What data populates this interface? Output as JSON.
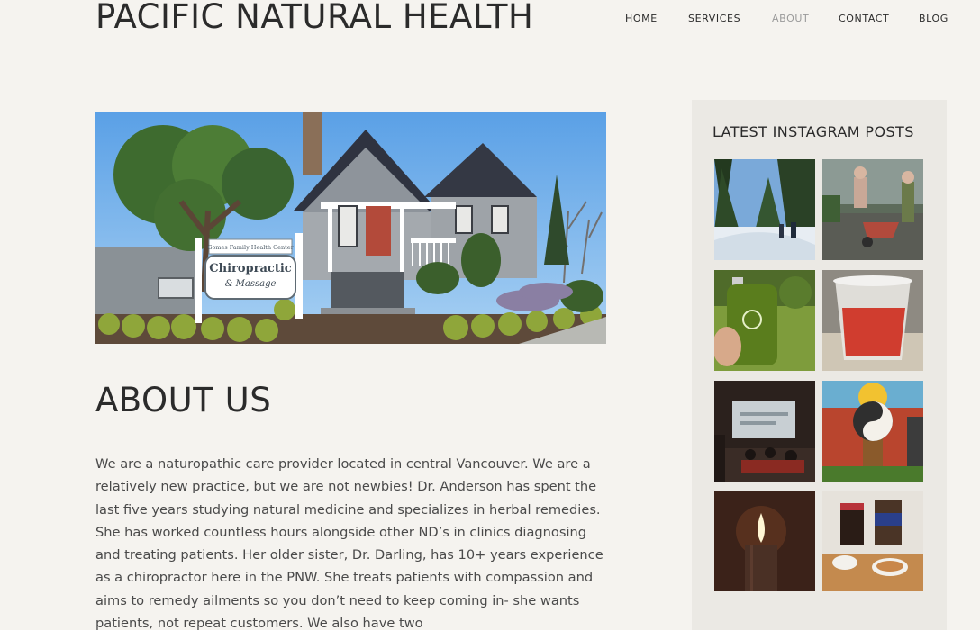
{
  "site": {
    "title": "PACIFIC NATURAL HEALTH"
  },
  "nav": {
    "items": [
      {
        "label": "HOME",
        "active": false
      },
      {
        "label": "SERVICES",
        "active": false
      },
      {
        "label": "ABOUT",
        "active": true
      },
      {
        "label": "CONTACT",
        "active": false
      },
      {
        "label": "BLOG",
        "active": false
      }
    ]
  },
  "hero": {
    "sign_line1": "Gomes Family Health Center",
    "sign_line2": "Chiropractic",
    "sign_line3": "& Massage"
  },
  "about": {
    "heading": "ABOUT US",
    "body": "We are a naturopathic care provider located in central Vancouver. We are a relatively new practice, but we are not newbies! Dr. Anderson has spent the last five years studying natural medicine and specializes in herbal remedies. She has worked countless hours alongside other ND’s in clinics diagnosing and treating patients. Her older sister, Dr. Darling, has 10+ years experience as a chiropractor here in the PNW. She treats patients with compassion and aims to remedy ailments so you don’t need to keep coming in- she wants patients, not repeat customers. We also have two"
  },
  "sidebar": {
    "instagram_title": "LATEST INSTAGRAM POSTS",
    "posts": [
      {
        "subject": "snowy forest trail"
      },
      {
        "subject": "garden wheelbarrow"
      },
      {
        "subject": "green juice bottle"
      },
      {
        "subject": "red drink cup"
      },
      {
        "subject": "seminar presentation"
      },
      {
        "subject": "yin yang tree painting"
      },
      {
        "subject": "candle flame"
      },
      {
        "subject": "jars and bowls"
      }
    ]
  },
  "colors": {
    "background": "#f5f3ef",
    "sidebar_bg": "#ebe9e4",
    "text": "#2b2b2b",
    "nav_active": "#9a9a9a"
  }
}
